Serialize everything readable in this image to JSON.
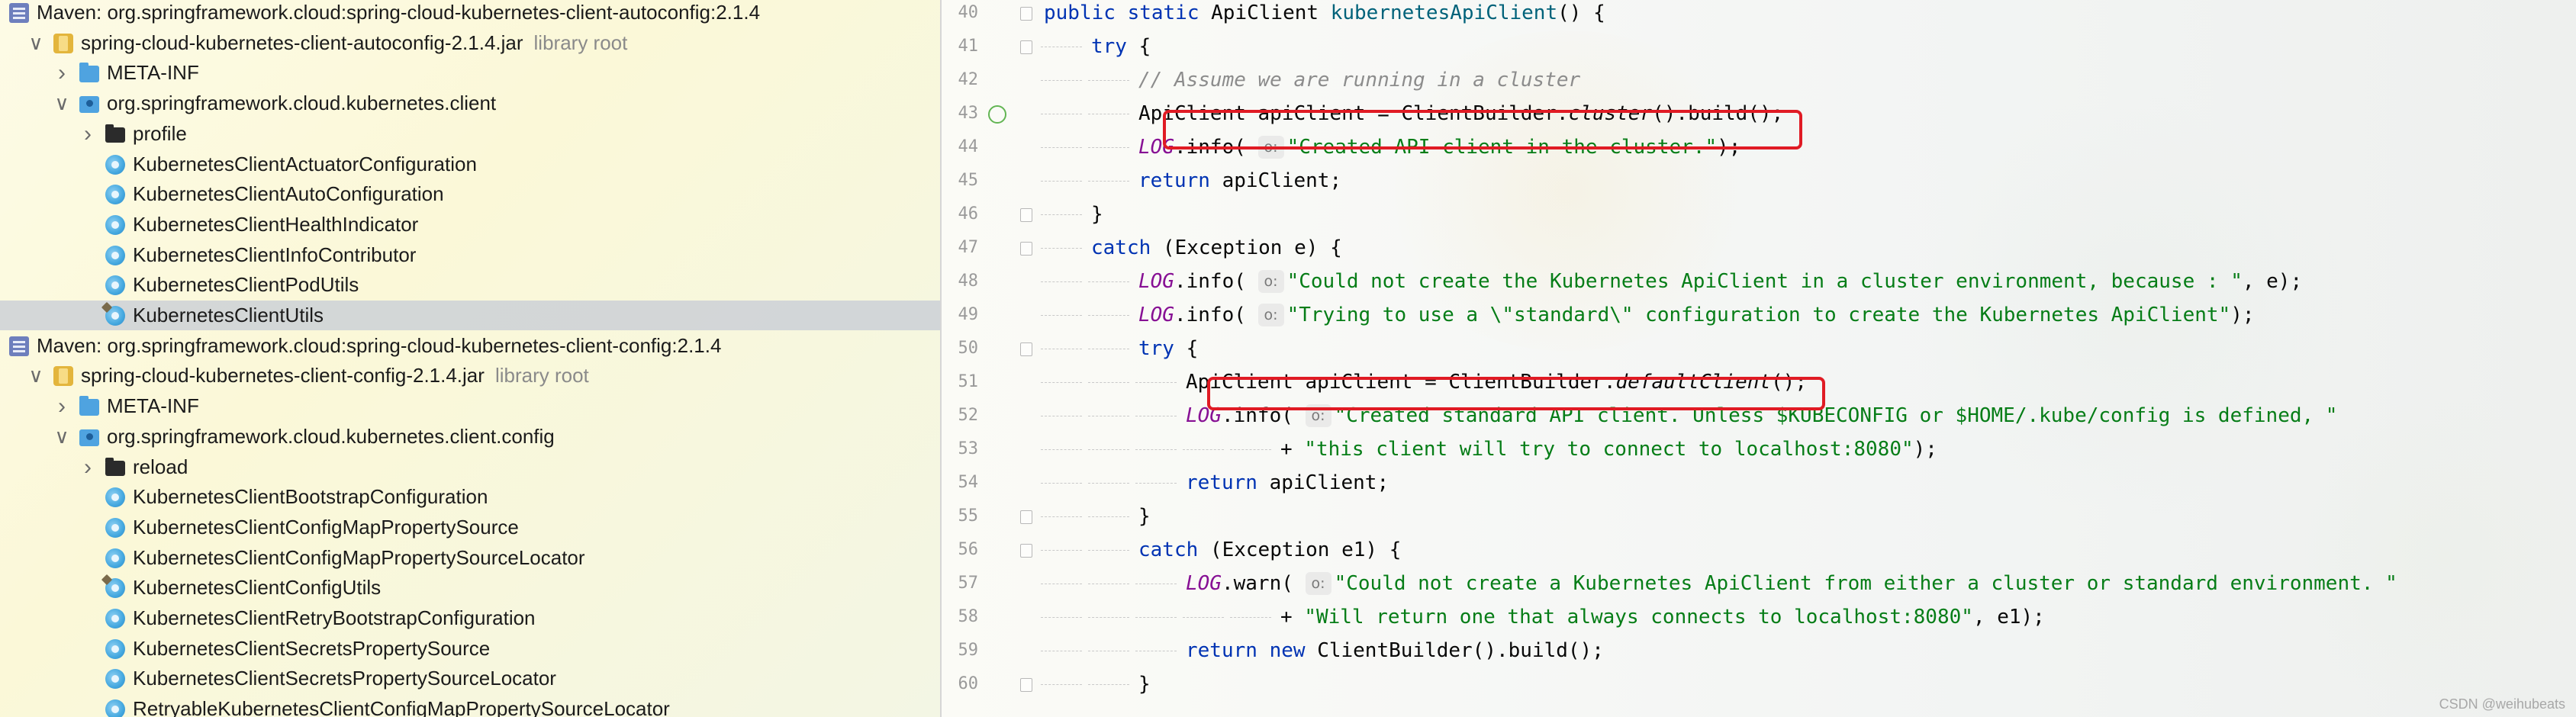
{
  "tree": {
    "rows": [
      {
        "arrow": "",
        "icon": "maven",
        "label": "Maven: org.springframework.cloud:spring-cloud-kubernetes-client-autoconfig:2.1.4",
        "suffix": ""
      },
      {
        "arrow": "expanded",
        "icon": "jar",
        "label": "spring-cloud-kubernetes-client-autoconfig-2.1.4.jar",
        "suffix": "library root"
      },
      {
        "arrow": "collapsed",
        "icon": "folder-blue",
        "label": "META-INF",
        "suffix": ""
      },
      {
        "arrow": "expanded",
        "icon": "package",
        "label": "org.springframework.cloud.kubernetes.client",
        "suffix": ""
      },
      {
        "arrow": "collapsed",
        "icon": "folder-black",
        "label": "profile",
        "suffix": ""
      },
      {
        "arrow": "",
        "icon": "class",
        "label": "KubernetesClientActuatorConfiguration",
        "suffix": ""
      },
      {
        "arrow": "",
        "icon": "class",
        "label": "KubernetesClientAutoConfiguration",
        "suffix": ""
      },
      {
        "arrow": "",
        "icon": "class",
        "label": "KubernetesClientHealthIndicator",
        "suffix": ""
      },
      {
        "arrow": "",
        "icon": "class",
        "label": "KubernetesClientInfoContributor",
        "suffix": ""
      },
      {
        "arrow": "",
        "icon": "class",
        "label": "KubernetesClientPodUtils",
        "suffix": ""
      },
      {
        "arrow": "",
        "icon": "class-util",
        "label": "KubernetesClientUtils",
        "suffix": "",
        "selected": true
      },
      {
        "arrow": "",
        "icon": "maven",
        "label": "Maven: org.springframework.cloud:spring-cloud-kubernetes-client-config:2.1.4",
        "suffix": ""
      },
      {
        "arrow": "expanded",
        "icon": "jar",
        "label": "spring-cloud-kubernetes-client-config-2.1.4.jar",
        "suffix": "library root"
      },
      {
        "arrow": "collapsed",
        "icon": "folder-blue",
        "label": "META-INF",
        "suffix": ""
      },
      {
        "arrow": "expanded",
        "icon": "package",
        "label": "org.springframework.cloud.kubernetes.client.config",
        "suffix": ""
      },
      {
        "arrow": "collapsed",
        "icon": "folder-black",
        "label": "reload",
        "suffix": ""
      },
      {
        "arrow": "",
        "icon": "class",
        "label": "KubernetesClientBootstrapConfiguration",
        "suffix": ""
      },
      {
        "arrow": "",
        "icon": "class",
        "label": "KubernetesClientConfigMapPropertySource",
        "suffix": ""
      },
      {
        "arrow": "",
        "icon": "class",
        "label": "KubernetesClientConfigMapPropertySourceLocator",
        "suffix": ""
      },
      {
        "arrow": "",
        "icon": "class-util",
        "label": "KubernetesClientConfigUtils",
        "suffix": ""
      },
      {
        "arrow": "",
        "icon": "class",
        "label": "KubernetesClientRetryBootstrapConfiguration",
        "suffix": ""
      },
      {
        "arrow": "",
        "icon": "class",
        "label": "KubernetesClientSecretsPropertySource",
        "suffix": ""
      },
      {
        "arrow": "",
        "icon": "class",
        "label": "KubernetesClientSecretsPropertySourceLocator",
        "suffix": ""
      },
      {
        "arrow": "",
        "icon": "class",
        "label": "RetryableKubernetesClientConfigMapPropertySourceLocator",
        "suffix": ""
      }
    ]
  },
  "editor": {
    "lines": [
      {
        "num": "40",
        "indent": 0,
        "fold": true,
        "tokens": [
          [
            "kw",
            "public static "
          ],
          [
            "",
            "ApiClient "
          ],
          [
            "mth",
            "kubernetesApiClient"
          ],
          [
            "",
            "() {"
          ]
        ]
      },
      {
        "num": "41",
        "indent": 1,
        "fold": true,
        "tokens": [
          [
            "kw",
            "try"
          ],
          [
            "",
            " {"
          ]
        ]
      },
      {
        "num": "42",
        "indent": 2,
        "tokens": [
          [
            "cm",
            "// Assume we are running in a cluster"
          ]
        ]
      },
      {
        "num": "43",
        "indent": 2,
        "run": true,
        "tokens": [
          [
            "",
            "ApiClient apiClient = ClientBuilder."
          ],
          [
            "ital",
            "cluster"
          ],
          [
            "",
            "().build();"
          ]
        ]
      },
      {
        "num": "44",
        "indent": 2,
        "tokens": [
          [
            "fld",
            "LOG"
          ],
          [
            "",
            ".info( "
          ],
          [
            "hint",
            "o:"
          ],
          [
            "str",
            "\"Created API client in the cluster.\""
          ],
          [
            "",
            ");"
          ]
        ]
      },
      {
        "num": "45",
        "indent": 2,
        "tokens": [
          [
            "kw",
            "return "
          ],
          [
            "",
            "apiClient;"
          ]
        ]
      },
      {
        "num": "46",
        "indent": 1,
        "fold": true,
        "tokens": [
          [
            "",
            "}"
          ]
        ]
      },
      {
        "num": "47",
        "indent": 1,
        "fold": true,
        "tokens": [
          [
            "kw",
            "catch "
          ],
          [
            "",
            "(Exception e) {"
          ]
        ]
      },
      {
        "num": "48",
        "indent": 2,
        "tokens": [
          [
            "fld",
            "LOG"
          ],
          [
            "",
            ".info( "
          ],
          [
            "hint",
            "o:"
          ],
          [
            "str",
            "\"Could not create the Kubernetes ApiClient in a cluster environment, because : \""
          ],
          [
            "",
            ", e);"
          ]
        ]
      },
      {
        "num": "49",
        "indent": 2,
        "tokens": [
          [
            "fld",
            "LOG"
          ],
          [
            "",
            ".info( "
          ],
          [
            "hint",
            "o:"
          ],
          [
            "str",
            "\"Trying to use a \\\"standard\\\" configuration to create the Kubernetes ApiClient\""
          ],
          [
            "",
            ");"
          ]
        ]
      },
      {
        "num": "50",
        "indent": 2,
        "fold": true,
        "tokens": [
          [
            "kw",
            "try"
          ],
          [
            "",
            " {"
          ]
        ]
      },
      {
        "num": "51",
        "indent": 3,
        "tokens": [
          [
            "",
            "ApiClient apiClient = ClientBuilder."
          ],
          [
            "ital",
            "defaultClient"
          ],
          [
            "",
            "();"
          ]
        ]
      },
      {
        "num": "52",
        "indent": 3,
        "tokens": [
          [
            "fld",
            "LOG"
          ],
          [
            "",
            ".info( "
          ],
          [
            "hint",
            "o:"
          ],
          [
            "str",
            "\"Created standard API client. Unless $KUBECONFIG or $HOME/.kube/config is defined, \""
          ]
        ]
      },
      {
        "num": "53",
        "indent": 5,
        "tokens": [
          [
            "",
            "+ "
          ],
          [
            "str",
            "\"this client will try to connect to localhost:8080\""
          ],
          [
            "",
            ");"
          ]
        ]
      },
      {
        "num": "54",
        "indent": 3,
        "tokens": [
          [
            "kw",
            "return "
          ],
          [
            "",
            "apiClient;"
          ]
        ]
      },
      {
        "num": "55",
        "indent": 2,
        "fold": true,
        "tokens": [
          [
            "",
            "}"
          ]
        ]
      },
      {
        "num": "56",
        "indent": 2,
        "fold": true,
        "tokens": [
          [
            "kw",
            "catch "
          ],
          [
            "",
            "(Exception e1) {"
          ]
        ]
      },
      {
        "num": "57",
        "indent": 3,
        "tokens": [
          [
            "fld",
            "LOG"
          ],
          [
            "",
            ".warn( "
          ],
          [
            "hint",
            "o:"
          ],
          [
            "str",
            "\"Could not create a Kubernetes ApiClient from either a cluster or standard environment. \""
          ]
        ]
      },
      {
        "num": "58",
        "indent": 5,
        "tokens": [
          [
            "",
            "+ "
          ],
          [
            "str",
            "\"Will return one that always connects to localhost:8080\""
          ],
          [
            "",
            ", e1);"
          ]
        ]
      },
      {
        "num": "59",
        "indent": 3,
        "tokens": [
          [
            "kw",
            "return new "
          ],
          [
            "",
            "ClientBuilder().build();"
          ]
        ]
      },
      {
        "num": "60",
        "indent": 2,
        "fold": true,
        "tokens": [
          [
            "",
            "}"
          ]
        ]
      }
    ]
  },
  "watermark": "CSDN @weihubeats",
  "colors": {
    "keyword": "#0033b3",
    "string": "#067d17",
    "comment": "#8c8c8c",
    "static_field": "#871094",
    "method_decl": "#00627a",
    "highlight_box": "#e01b24",
    "selection": "#c8cdd6"
  }
}
